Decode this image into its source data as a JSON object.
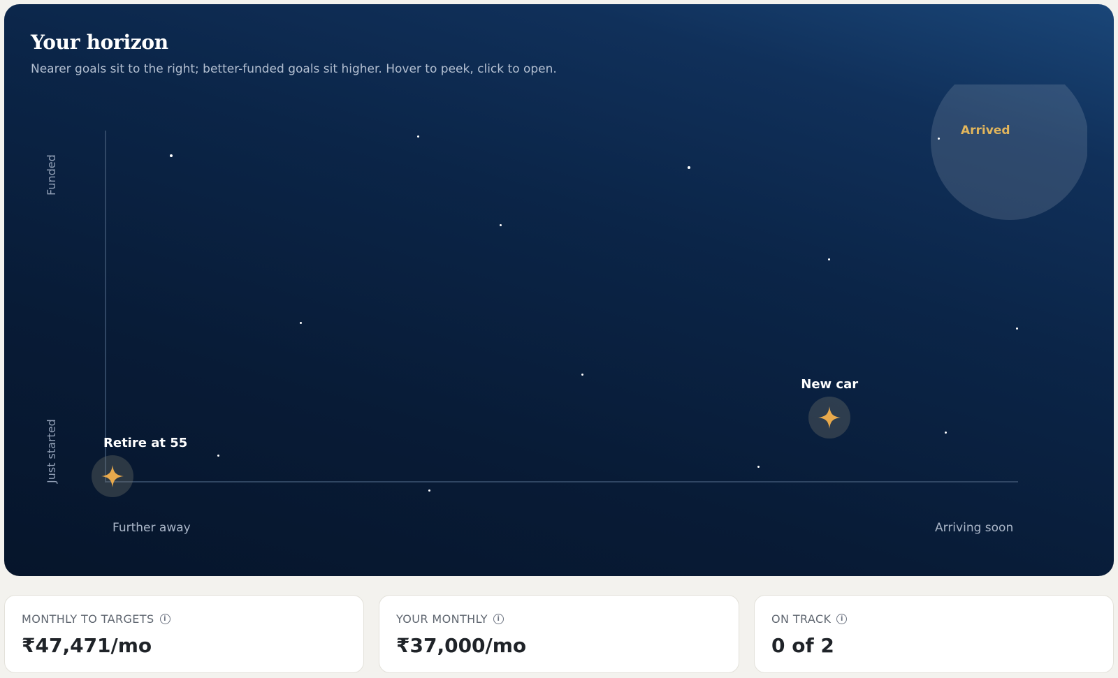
{
  "horizon": {
    "title": "Your horizon",
    "subtitle": "Nearer goals sit to the right; better-funded goals sit higher. Hover to peek, click to open.",
    "axes": {
      "y_top": "Funded",
      "y_bottom": "Just started",
      "x_left": "Further away",
      "x_right": "Arriving soon"
    },
    "arrived_label": "Arrived",
    "colors": {
      "star": "#e8a94c",
      "arrived": "#e2b65c"
    },
    "goals": [
      {
        "name": "Retire at 55",
        "nearness": 0.0,
        "funded": 0.0
      },
      {
        "name": "New car",
        "nearness": 0.79,
        "funded": 0.17
      }
    ]
  },
  "stats": {
    "monthly_to_targets": {
      "label": "MONTHLY TO TARGETS",
      "value": "₹47,471/mo"
    },
    "your_monthly": {
      "label": "YOUR MONTHLY",
      "value": "₹37,000/mo"
    },
    "on_track": {
      "label": "ON TRACK",
      "value": "0 of 2"
    }
  }
}
